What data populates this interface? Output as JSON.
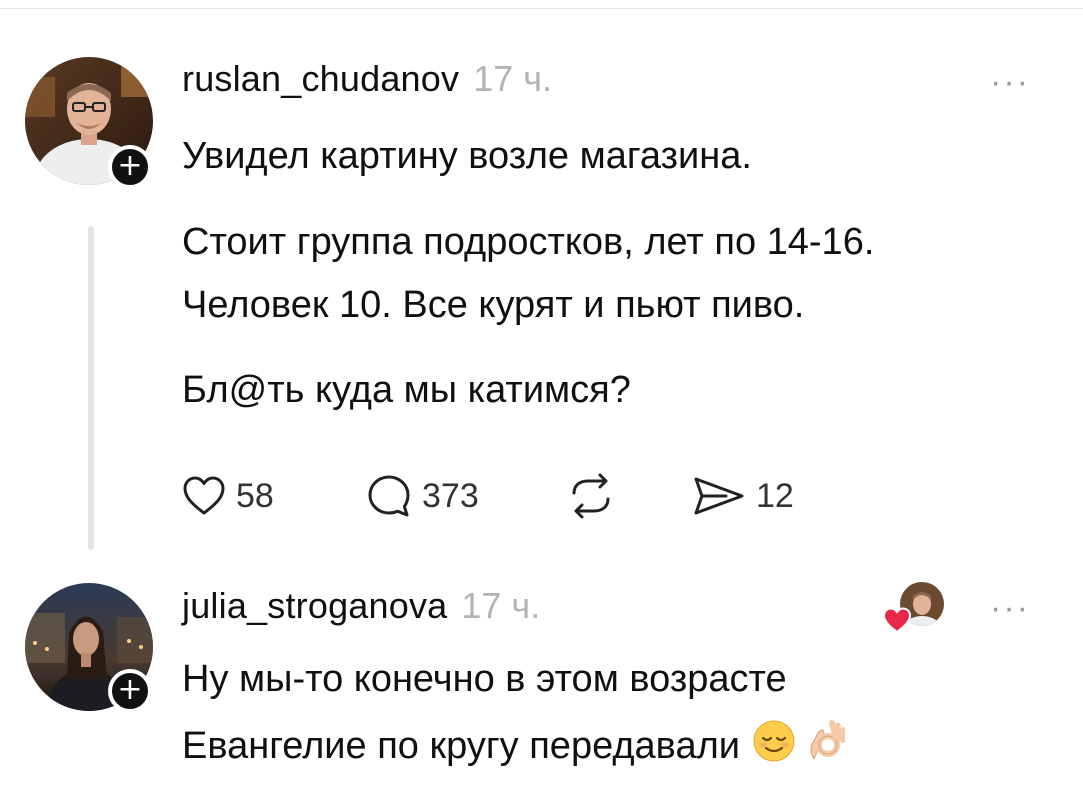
{
  "posts": [
    {
      "username": "ruslan_chudanov",
      "timestamp": "17 ч.",
      "more": "···",
      "follow_symbol": "+",
      "paragraphs": [
        [
          "Увидел картину возле магазина."
        ],
        [
          "Стоит группа подростков, лет по 14-16.",
          "Человек 10. Все курят и пьют пиво."
        ],
        [
          "Бл@ть куда мы катимся?"
        ]
      ],
      "actions": {
        "likes": "58",
        "replies": "373",
        "shares": "12"
      }
    },
    {
      "username": "julia_stroganova",
      "timestamp": "17 ч.",
      "more": "···",
      "follow_symbol": "+",
      "lines": [
        "Ну мы-то конечно в этом возрасте",
        "Евангелие по кругу передавали"
      ]
    }
  ],
  "colors": {
    "text": "#101010",
    "muted": "#b3b3b3",
    "heart_badge": "#e8284a",
    "follow_badge": "#111111"
  },
  "icons": [
    "heart-icon",
    "comment-icon",
    "repost-icon",
    "send-icon",
    "relieved-face-emoji",
    "ok-hand-emoji"
  ]
}
